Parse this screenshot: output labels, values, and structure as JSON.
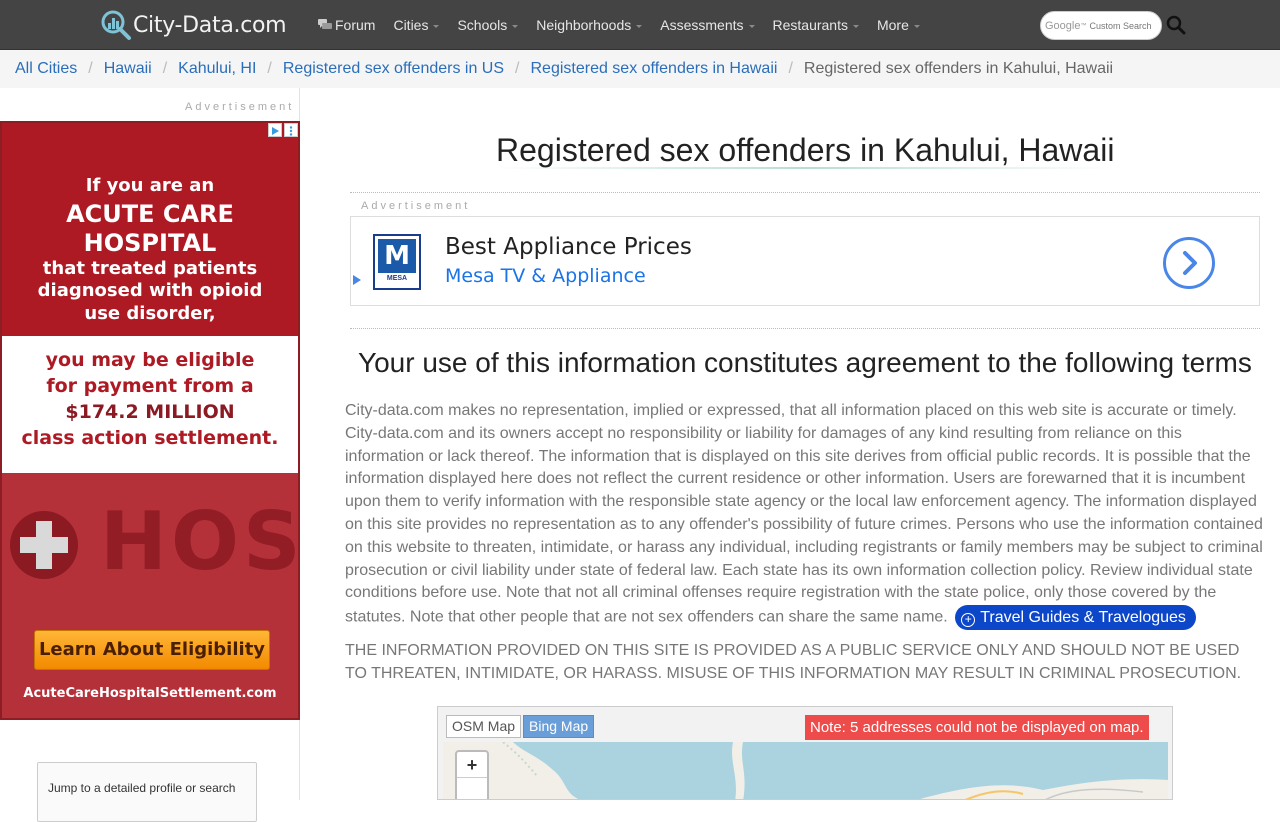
{
  "header": {
    "logo_text": "City-Data.com",
    "nav": [
      {
        "label": "Forum",
        "icon": "forum-icon"
      },
      {
        "label": "Cities"
      },
      {
        "label": "Schools"
      },
      {
        "label": "Neighborhoods"
      },
      {
        "label": "Assessments"
      },
      {
        "label": "Restaurants"
      },
      {
        "label": "More"
      }
    ],
    "search": {
      "google_label": "Google",
      "custom_label": "Custom Search",
      "icon": "search-icon"
    }
  },
  "breadcrumb": [
    "All Cities",
    "Hawaii",
    "Kahului, HI",
    "Registered sex offenders in US",
    "Registered sex offenders in Hawaii",
    "Registered sex offenders in Kahului, Hawaii"
  ],
  "sidebar": {
    "ad_label": "Advertisement",
    "ad": {
      "line1": "If you are an",
      "line2": "ACUTE CARE",
      "line3": "HOSPITAL",
      "line4": "that treated patients",
      "line5": "diagnosed with opioid",
      "line6": "use disorder,",
      "line7": "you may be eligible",
      "line8": "for payment from a",
      "line9": "$174.2 MILLION",
      "line10": "class action settlement.",
      "image_word": "HOSP",
      "cta": "Learn About Eligibility",
      "url": "AcuteCareHospitalSettlement.com"
    },
    "jump_text": "Jump to a detailed profile or search"
  },
  "main": {
    "title": "Registered sex offenders in Kahului, Hawaii",
    "ad_label": "Advertisement",
    "ad": {
      "logo_letter": "M",
      "logo_text": "MESA",
      "headline": "Best Appliance Prices",
      "advertiser": "Mesa TV & Appliance"
    },
    "terms_heading": "Your use of this information constitutes agreement to the following terms",
    "terms_body": "City-data.com makes no representation, implied or expressed, that all information placed on this web site is accurate or timely. City-data.com and its owners accept no responsibility or liability for damages of any kind resulting from reliance on this information or lack thereof. The information that is displayed on this site derives from official public records. It is possible that the information displayed here does not reflect the current residence or other information. Users are forewarned that it is incumbent upon them to verify information with the responsible state agency or the local law enforcement agency. The information displayed on this site provides no representation as to any offender's possibility of future crimes. Persons who use the information contained on this website to threaten, intimidate, or harass any individual, including registrants or family members may be subject to criminal prosecution or civil liability under state of federal law. Each state has its own information collection policy. Review individual state conditions before use. Note that not all criminal offenses require registration with the state police, only those covered by the statutes. Note that other people that are not sex offenders can share the same name.",
    "travel_button": "Travel Guides & Travelogues",
    "disclaimer": "THE INFORMATION PROVIDED ON THIS SITE IS PROVIDED AS A PUBLIC SERVICE ONLY AND SHOULD NOT BE USED TO THREATEN, INTIMIDATE, OR HARASS. MISUSE OF THIS INFORMATION MAY RESULT IN CRIMINAL PROSECUTION.",
    "map": {
      "tab_osm": "OSM Map",
      "tab_bing": "Bing Map",
      "note": "Note: 5 addresses could not be displayed on map.",
      "zoom_in": "+"
    }
  },
  "colors": {
    "navbar": "#444444",
    "link": "#2a6ebb",
    "ad_red": "#ad1a24",
    "cta_orange": "#f28a00",
    "travel_blue": "#0d47c9",
    "map_note_red": "#ee4b4b"
  }
}
